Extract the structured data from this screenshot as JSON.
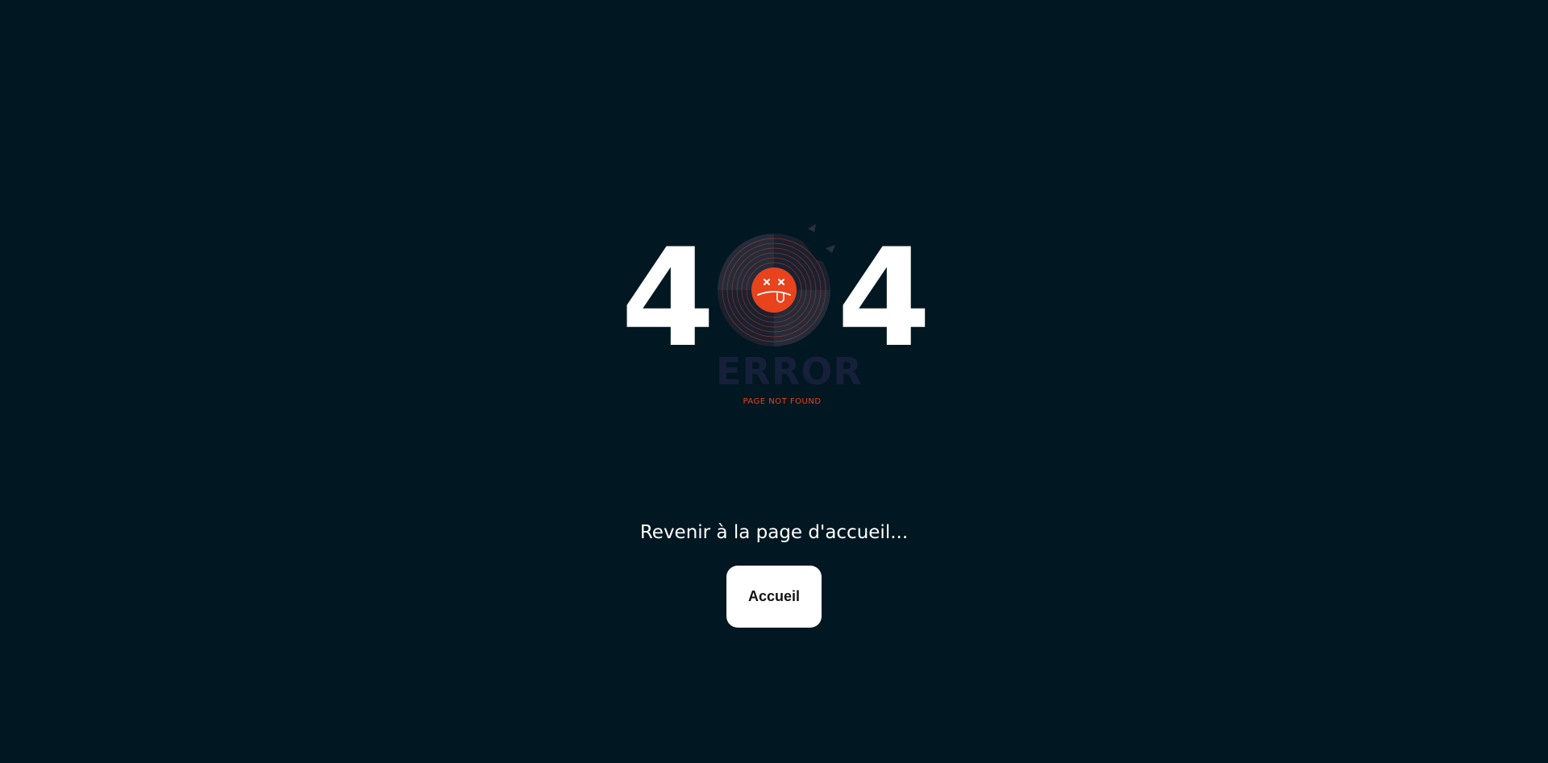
{
  "error_graphic": {
    "digit_left": "4",
    "digit_right": "4",
    "error_label": "ERROR",
    "subtitle": "PAGE NOT FOUND"
  },
  "message": "Revenir à la page d'accueil...",
  "home_button_label": "Accueil",
  "colors": {
    "background": "#011722",
    "accent": "#e8431c",
    "disc": "#2a3040",
    "button_bg": "#ffffff",
    "text": "#ffffff"
  }
}
